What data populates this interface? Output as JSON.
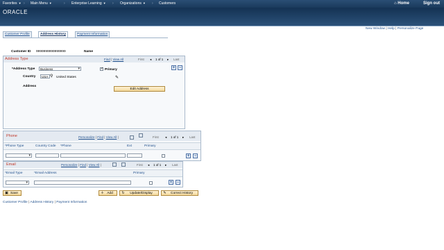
{
  "nav": {
    "favorites": "Favorites",
    "main_menu": "Main Menu",
    "crumb1": "Enterprise Learning",
    "crumb2": "Organizations",
    "crumb3": "Customers",
    "home": "Home",
    "signout": "Sign out"
  },
  "brand": {
    "logo": "ORACLE"
  },
  "toplinks": {
    "new_window": "New Window",
    "help": "Help",
    "personalize": "Personalize Page"
  },
  "tabs": [
    {
      "label": "Customer Profile"
    },
    {
      "label": "Address History"
    },
    {
      "label": "Payment Information"
    }
  ],
  "customer": {
    "id_label": "Customer ID",
    "id_value": "9999999999999999",
    "name_label": "Name"
  },
  "address": {
    "title": "Address Type",
    "find": "Find",
    "view_all": "View All",
    "first": "First",
    "count": "1 of 1",
    "last": "Last",
    "type_label": "*Address Type",
    "type_value": "Business",
    "primary_label": "Primary",
    "country_label": "Country",
    "country_code": "USA",
    "country_name": "United States",
    "address_label": "Address",
    "edit_button": "Edit Address"
  },
  "phone": {
    "title": "Phone",
    "personalize": "Personalize",
    "find": "Find",
    "view_all": "View All",
    "first": "First",
    "count": "1 of 1",
    "last": "Last",
    "col_type": "*Phone Type",
    "col_country": "Country Code",
    "col_phone": "*Phone",
    "col_ext": "Ext",
    "col_primary": "Primary"
  },
  "email": {
    "title": "Email",
    "personalize": "Personalize",
    "find": "Find",
    "view_all": "View All",
    "first": "First",
    "count": "1 of 1",
    "last": "Last",
    "col_type": "*Email Type",
    "col_address": "*Email Address",
    "col_primary": "Primary"
  },
  "actions": {
    "save": "Save",
    "add": "Add",
    "update": "Update/Display",
    "correct": "Correct History"
  },
  "footer": {
    "link1": "Customer Profile",
    "link2": "Address History",
    "link3": "Payment Information"
  },
  "colors": {
    "nav_bg": "#1a3a5c",
    "link": "#1f4f8c",
    "section_title": "#c0392b"
  },
  "icons": [
    "home-icon",
    "search-icon",
    "edit-icon",
    "grid-icon",
    "save-icon",
    "add-icon",
    "update-icon",
    "history-icon"
  ]
}
